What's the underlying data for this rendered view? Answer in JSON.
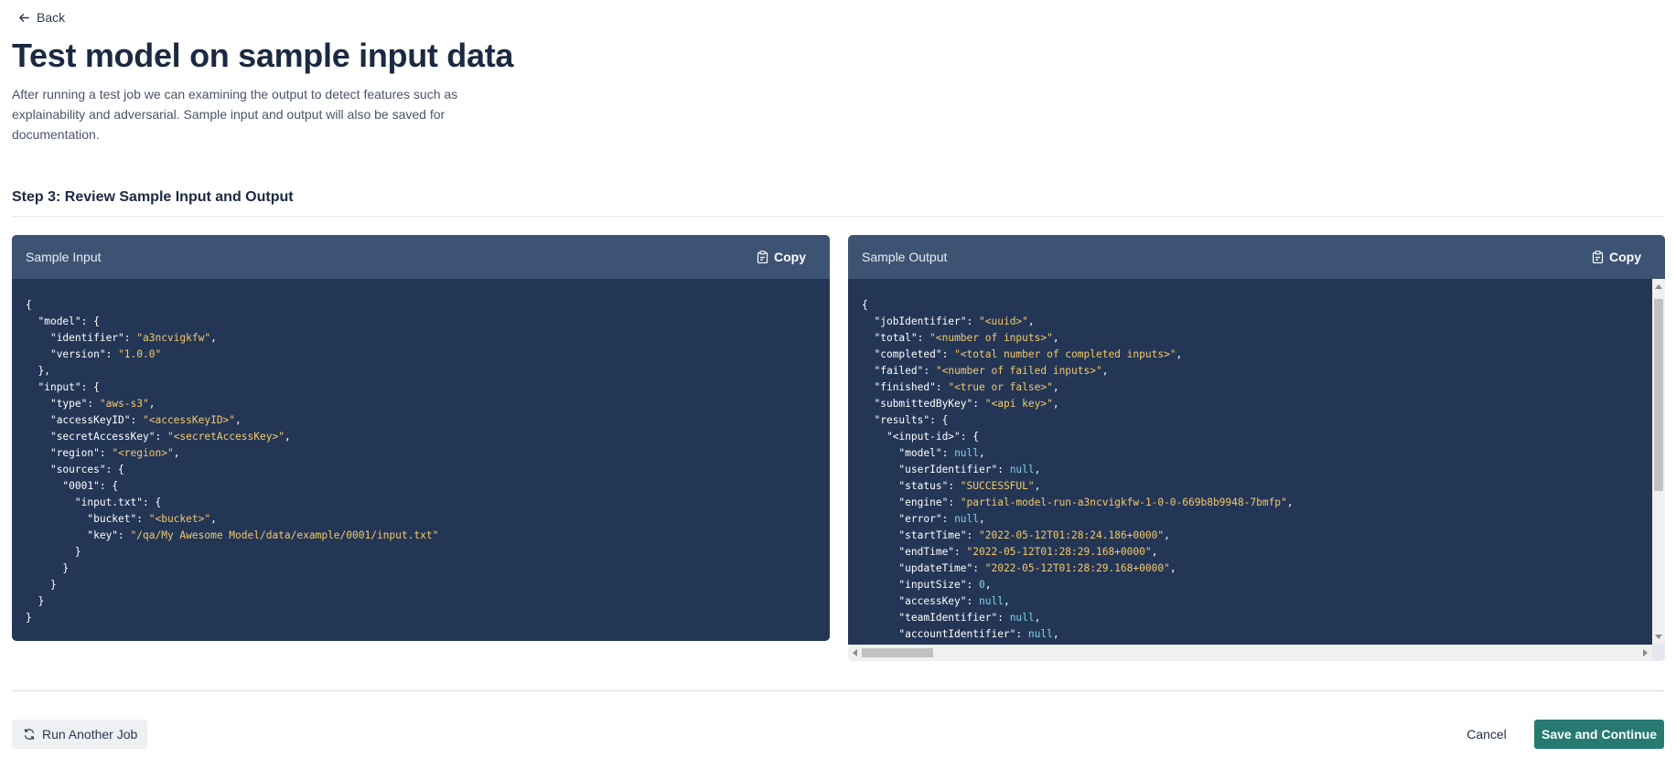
{
  "nav": {
    "back_label": "Back"
  },
  "header": {
    "title": "Test model on sample input data",
    "description": "After running a test job we can examining the output to detect features such as explainability and adversarial. Sample input and output will also be saved for documentation."
  },
  "step": {
    "title": "Step 3: Review Sample Input and Output"
  },
  "sample_input": {
    "title": "Sample Input",
    "copy_label": "Copy",
    "lines": [
      [
        [
          "p",
          "{"
        ]
      ],
      [
        [
          "p",
          "  "
        ],
        [
          "k",
          "\"model\""
        ],
        [
          "p",
          ": {"
        ]
      ],
      [
        [
          "p",
          "    "
        ],
        [
          "k",
          "\"identifier\""
        ],
        [
          "p",
          ": "
        ],
        [
          "s",
          "\"a3ncvigkfw\""
        ],
        [
          "p",
          ","
        ]
      ],
      [
        [
          "p",
          "    "
        ],
        [
          "k",
          "\"version\""
        ],
        [
          "p",
          ": "
        ],
        [
          "s",
          "\"1.0.0\""
        ]
      ],
      [
        [
          "p",
          "  },"
        ]
      ],
      [
        [
          "p",
          "  "
        ],
        [
          "k",
          "\"input\""
        ],
        [
          "p",
          ": {"
        ]
      ],
      [
        [
          "p",
          "    "
        ],
        [
          "k",
          "\"type\""
        ],
        [
          "p",
          ": "
        ],
        [
          "s",
          "\"aws-s3\""
        ],
        [
          "p",
          ","
        ]
      ],
      [
        [
          "p",
          "    "
        ],
        [
          "k",
          "\"accessKeyID\""
        ],
        [
          "p",
          ": "
        ],
        [
          "s",
          "\"<accessKeyID>\""
        ],
        [
          "p",
          ","
        ]
      ],
      [
        [
          "p",
          "    "
        ],
        [
          "k",
          "\"secretAccessKey\""
        ],
        [
          "p",
          ": "
        ],
        [
          "s",
          "\"<secretAccessKey>\""
        ],
        [
          "p",
          ","
        ]
      ],
      [
        [
          "p",
          "    "
        ],
        [
          "k",
          "\"region\""
        ],
        [
          "p",
          ": "
        ],
        [
          "s",
          "\"<region>\""
        ],
        [
          "p",
          ","
        ]
      ],
      [
        [
          "p",
          "    "
        ],
        [
          "k",
          "\"sources\""
        ],
        [
          "p",
          ": {"
        ]
      ],
      [
        [
          "p",
          "      "
        ],
        [
          "k",
          "\"0001\""
        ],
        [
          "p",
          ": {"
        ]
      ],
      [
        [
          "p",
          "        "
        ],
        [
          "k",
          "\"input.txt\""
        ],
        [
          "p",
          ": {"
        ]
      ],
      [
        [
          "p",
          "          "
        ],
        [
          "k",
          "\"bucket\""
        ],
        [
          "p",
          ": "
        ],
        [
          "s",
          "\"<bucket>\""
        ],
        [
          "p",
          ","
        ]
      ],
      [
        [
          "p",
          "          "
        ],
        [
          "k",
          "\"key\""
        ],
        [
          "p",
          ": "
        ],
        [
          "s",
          "\"/qa/My Awesome Model/data/example/0001/input.txt\""
        ]
      ],
      [
        [
          "p",
          "        }"
        ]
      ],
      [
        [
          "p",
          "      }"
        ]
      ],
      [
        [
          "p",
          "    }"
        ]
      ],
      [
        [
          "p",
          "  }"
        ]
      ],
      [
        [
          "p",
          "}"
        ]
      ]
    ]
  },
  "sample_output": {
    "title": "Sample Output",
    "copy_label": "Copy",
    "lines": [
      [
        [
          "p",
          "{"
        ]
      ],
      [
        [
          "p",
          "  "
        ],
        [
          "k",
          "\"jobIdentifier\""
        ],
        [
          "p",
          ": "
        ],
        [
          "s",
          "\"<uuid>\""
        ],
        [
          "p",
          ","
        ]
      ],
      [
        [
          "p",
          "  "
        ],
        [
          "k",
          "\"total\""
        ],
        [
          "p",
          ": "
        ],
        [
          "s",
          "\"<number of inputs>\""
        ],
        [
          "p",
          ","
        ]
      ],
      [
        [
          "p",
          "  "
        ],
        [
          "k",
          "\"completed\""
        ],
        [
          "p",
          ": "
        ],
        [
          "s",
          "\"<total number of completed inputs>\""
        ],
        [
          "p",
          ","
        ]
      ],
      [
        [
          "p",
          "  "
        ],
        [
          "k",
          "\"failed\""
        ],
        [
          "p",
          ": "
        ],
        [
          "s",
          "\"<number of failed inputs>\""
        ],
        [
          "p",
          ","
        ]
      ],
      [
        [
          "p",
          "  "
        ],
        [
          "k",
          "\"finished\""
        ],
        [
          "p",
          ": "
        ],
        [
          "s",
          "\"<true or false>\""
        ],
        [
          "p",
          ","
        ]
      ],
      [
        [
          "p",
          "  "
        ],
        [
          "k",
          "\"submittedByKey\""
        ],
        [
          "p",
          ": "
        ],
        [
          "s",
          "\"<api key>\""
        ],
        [
          "p",
          ","
        ]
      ],
      [
        [
          "p",
          "  "
        ],
        [
          "k",
          "\"results\""
        ],
        [
          "p",
          ": {"
        ]
      ],
      [
        [
          "p",
          "    "
        ],
        [
          "k",
          "\"<input-id>\""
        ],
        [
          "p",
          ": {"
        ]
      ],
      [
        [
          "p",
          "      "
        ],
        [
          "k",
          "\"model\""
        ],
        [
          "p",
          ": "
        ],
        [
          "n",
          "null"
        ],
        [
          "p",
          ","
        ]
      ],
      [
        [
          "p",
          "      "
        ],
        [
          "k",
          "\"userIdentifier\""
        ],
        [
          "p",
          ": "
        ],
        [
          "n",
          "null"
        ],
        [
          "p",
          ","
        ]
      ],
      [
        [
          "p",
          "      "
        ],
        [
          "k",
          "\"status\""
        ],
        [
          "p",
          ": "
        ],
        [
          "s",
          "\"SUCCESSFUL\""
        ],
        [
          "p",
          ","
        ]
      ],
      [
        [
          "p",
          "      "
        ],
        [
          "k",
          "\"engine\""
        ],
        [
          "p",
          ": "
        ],
        [
          "s",
          "\"partial-model-run-a3ncvigkfw-1-0-0-669b8b9948-7bmfp\""
        ],
        [
          "p",
          ","
        ]
      ],
      [
        [
          "p",
          "      "
        ],
        [
          "k",
          "\"error\""
        ],
        [
          "p",
          ": "
        ],
        [
          "n",
          "null"
        ],
        [
          "p",
          ","
        ]
      ],
      [
        [
          "p",
          "      "
        ],
        [
          "k",
          "\"startTime\""
        ],
        [
          "p",
          ": "
        ],
        [
          "s",
          "\"2022-05-12T01:28:24.186+0000\""
        ],
        [
          "p",
          ","
        ]
      ],
      [
        [
          "p",
          "      "
        ],
        [
          "k",
          "\"endTime\""
        ],
        [
          "p",
          ": "
        ],
        [
          "s",
          "\"2022-05-12T01:28:29.168+0000\""
        ],
        [
          "p",
          ","
        ]
      ],
      [
        [
          "p",
          "      "
        ],
        [
          "k",
          "\"updateTime\""
        ],
        [
          "p",
          ": "
        ],
        [
          "s",
          "\"2022-05-12T01:28:29.168+0000\""
        ],
        [
          "p",
          ","
        ]
      ],
      [
        [
          "p",
          "      "
        ],
        [
          "k",
          "\"inputSize\""
        ],
        [
          "p",
          ": "
        ],
        [
          "n",
          "0"
        ],
        [
          "p",
          ","
        ]
      ],
      [
        [
          "p",
          "      "
        ],
        [
          "k",
          "\"accessKey\""
        ],
        [
          "p",
          ": "
        ],
        [
          "n",
          "null"
        ],
        [
          "p",
          ","
        ]
      ],
      [
        [
          "p",
          "      "
        ],
        [
          "k",
          "\"teamIdentifier\""
        ],
        [
          "p",
          ": "
        ],
        [
          "n",
          "null"
        ],
        [
          "p",
          ","
        ]
      ],
      [
        [
          "p",
          "      "
        ],
        [
          "k",
          "\"accountIdentifier\""
        ],
        [
          "p",
          ": "
        ],
        [
          "n",
          "null"
        ],
        [
          "p",
          ","
        ]
      ]
    ]
  },
  "footer": {
    "run_another_label": "Run Another Job",
    "cancel_label": "Cancel",
    "save_label": "Save and Continue"
  },
  "colors": {
    "accent": "#267a72",
    "panel_header": "#3d5373",
    "panel_body": "#243656",
    "json_string": "#f3c969",
    "json_literal": "#7fd3e6"
  },
  "icons": {
    "back": "arrow-left-icon",
    "copy": "clipboard-icon",
    "run_another": "refresh-icon"
  }
}
